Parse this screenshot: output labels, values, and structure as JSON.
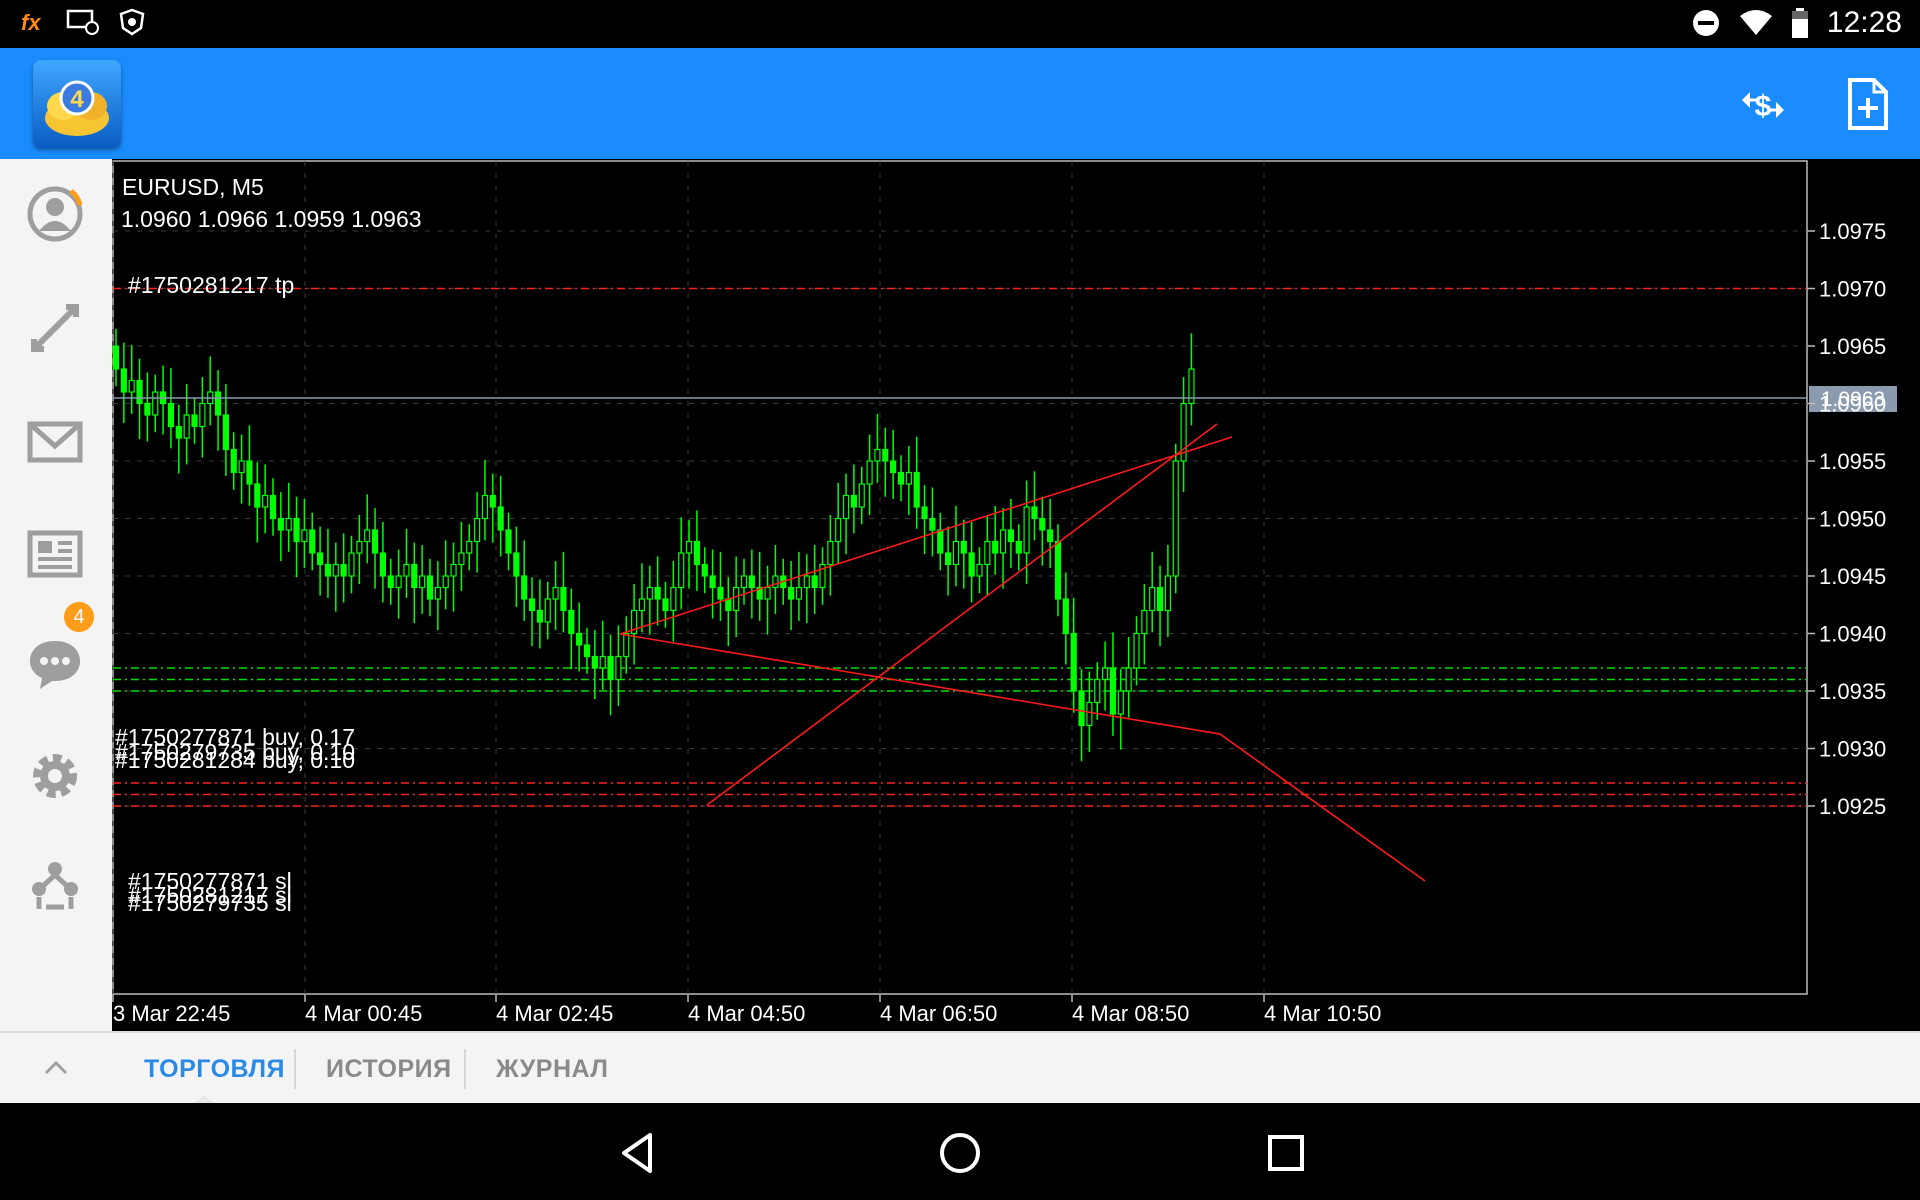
{
  "status_bar": {
    "time": "12:28",
    "icons": [
      "fx-icon",
      "remote-display-icon",
      "shield-icon",
      "do-not-disturb-icon",
      "wifi-icon",
      "battery-icon"
    ]
  },
  "app_bar": {
    "logo": "metatrader-4-logo",
    "actions": [
      {
        "name": "trade-icon"
      },
      {
        "name": "new-order-icon"
      }
    ]
  },
  "sidebar": {
    "items": [
      {
        "name": "accounts-icon"
      },
      {
        "name": "trade-arrows-icon"
      },
      {
        "name": "mail-icon",
        "badge": "4"
      },
      {
        "name": "news-icon"
      },
      {
        "name": "chat-icon"
      },
      {
        "name": "settings-icon"
      },
      {
        "name": "traders-community-icon"
      }
    ]
  },
  "chart": {
    "symbol": "EURUSD, M5",
    "ohlc": "1.0960 1.0966 1.0959 1.0963",
    "current_price": "1.0963",
    "price_labels": [
      "1.0975",
      "1.0970",
      "1.0965",
      "1.0960",
      "1.0955",
      "1.0950",
      "1.0945",
      "1.0940",
      "1.0935",
      "1.0930",
      "1.0925"
    ],
    "time_labels": [
      "3 Mar 22:45",
      "4 Mar 00:45",
      "4 Mar 02:45",
      "4 Mar 04:50",
      "4 Mar 06:50",
      "4 Mar 08:50",
      "4 Mar 10:50"
    ],
    "orders": {
      "tp_label": "#1750281217 tp",
      "buy_label_1": "#1750277871 buy, 0.17",
      "buy_label_2": "#1750281284 buy, 0.10",
      "buy_label_3": "#1750279735 buy, 0.10",
      "sl_label_1": "#1750277871 sl",
      "sl_label_2": "#1750281217 sl",
      "sl_label_3": "#1750279735 sl"
    },
    "levels": {
      "tp": 1.097,
      "buys": [
        1.0937,
        1.0936,
        1.0935
      ],
      "sls": [
        1.0927,
        1.0926,
        1.0925
      ]
    },
    "colors": {
      "bull": "#00ff00",
      "tp_sl": "#ff2020",
      "buy_line": "#00e000",
      "trendline": "#ff1a1a",
      "price_line": "#8a9bb0",
      "grid": "#3a3a3a"
    }
  },
  "chart_data": {
    "type": "candlestick",
    "title": "EURUSD, M5",
    "ylim": [
      1.0919,
      1.098
    ],
    "x_labels": [
      "3 Mar 22:45",
      "4 Mar 00:45",
      "4 Mar 02:45",
      "4 Mar 04:50",
      "4 Mar 06:50",
      "4 Mar 08:50",
      "4 Mar 10:50"
    ],
    "close_series": [
      1.0963,
      1.0961,
      1.0962,
      1.096,
      1.0959,
      1.0961,
      1.096,
      1.0958,
      1.0957,
      1.0959,
      1.0958,
      1.096,
      1.0961,
      1.0959,
      1.0956,
      1.0954,
      1.0955,
      1.0953,
      1.0951,
      1.0952,
      1.095,
      1.0949,
      1.095,
      1.0948,
      1.0949,
      1.0947,
      1.0946,
      1.0945,
      1.0946,
      1.0945,
      1.0947,
      1.0948,
      1.0949,
      1.0947,
      1.0945,
      1.0944,
      1.0945,
      1.0946,
      1.0944,
      1.0945,
      1.0943,
      1.0944,
      1.0945,
      1.0946,
      1.0947,
      1.0948,
      1.095,
      1.0952,
      1.0951,
      1.0949,
      1.0947,
      1.0945,
      1.0943,
      1.0942,
      1.0941,
      1.0943,
      1.0944,
      1.0942,
      1.094,
      1.0939,
      1.0938,
      1.0937,
      1.0938,
      1.0936,
      1.0938,
      1.094,
      1.0942,
      1.0943,
      1.0944,
      1.0943,
      1.0942,
      1.0944,
      1.0947,
      1.0948,
      1.0946,
      1.0945,
      1.0944,
      1.0943,
      1.0942,
      1.0944,
      1.0945,
      1.0944,
      1.0943,
      1.0944,
      1.0945,
      1.0944,
      1.0943,
      1.0944,
      1.0945,
      1.0944,
      1.0946,
      1.0948,
      1.095,
      1.0952,
      1.0951,
      1.0953,
      1.0955,
      1.0956,
      1.0955,
      1.0954,
      1.0953,
      1.0954,
      1.0951,
      1.095,
      1.0949,
      1.0947,
      1.0946,
      1.0948,
      1.0947,
      1.0945,
      1.0946,
      1.0948,
      1.0947,
      1.0949,
      1.0948,
      1.0947,
      1.0951,
      1.095,
      1.0949,
      1.0948,
      1.0943,
      1.094,
      1.0935,
      1.0932,
      1.0934,
      1.0936,
      1.0937,
      1.0933,
      1.0935,
      1.0937,
      1.094,
      1.0942,
      1.0944,
      1.0942,
      1.0945,
      1.0955,
      1.096,
      1.0963
    ],
    "y_labels": [
      "1.0975",
      "1.0970",
      "1.0965",
      "1.0960",
      "1.0955",
      "1.0950",
      "1.0945",
      "1.0940",
      "1.0935",
      "1.0930",
      "1.0925"
    ]
  },
  "tabs": [
    {
      "label": "ТОРГОВЛЯ",
      "active": true
    },
    {
      "label": "ИСТОРИЯ",
      "active": false
    },
    {
      "label": "ЖУРНАЛ",
      "active": false
    }
  ],
  "nav": {
    "back": "back-icon",
    "home": "home-icon",
    "recents": "recents-icon"
  }
}
